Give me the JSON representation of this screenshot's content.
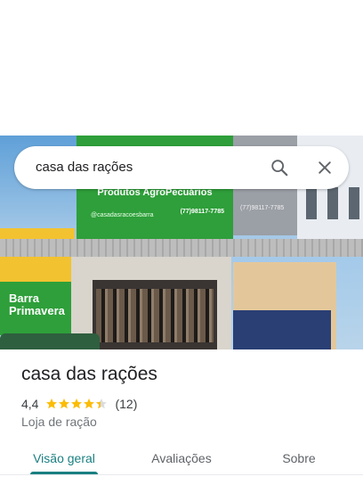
{
  "search": {
    "query": "casa das rações",
    "search_icon": "search-icon",
    "close_icon": "close-icon"
  },
  "photo": {
    "sign_title": "Produtos AgroPecuários",
    "sign_handle": "@casadasracoesbarra",
    "sign_phone": "(77)98117-7785",
    "grey_sign_phone": "(77)98117-7785",
    "barra_text": "Barra Primavera"
  },
  "place": {
    "name": "casa das rações",
    "rating": "4,4",
    "stars": 4.4,
    "review_count": "(12)",
    "category": "Loja de ração"
  },
  "tabs": [
    {
      "label": "Visão geral",
      "active": true
    },
    {
      "label": "Avaliações",
      "active": false
    },
    {
      "label": "Sobre",
      "active": false
    }
  ],
  "colors": {
    "accent": "#1a7f80",
    "star": "#fbbc04"
  }
}
